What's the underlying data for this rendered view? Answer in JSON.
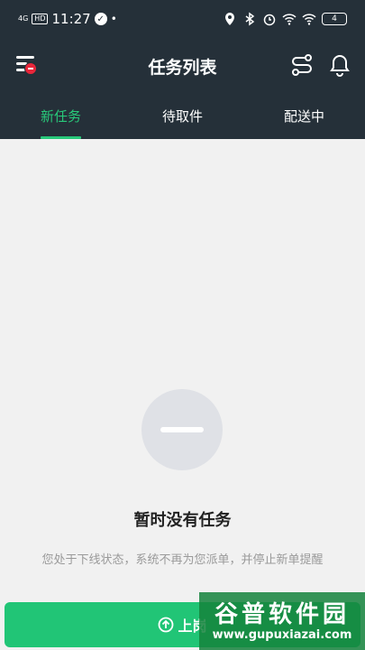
{
  "status_bar": {
    "signal": "4G",
    "hd": "HD",
    "time": "11:27",
    "battery": "4"
  },
  "header": {
    "title": "任务列表",
    "icons": {
      "menu": "menu-icon",
      "route": "route-icon",
      "bell": "bell-icon"
    }
  },
  "tabs": [
    {
      "label": "新任务",
      "active": true
    },
    {
      "label": "待取件",
      "active": false
    },
    {
      "label": "配送中",
      "active": false
    }
  ],
  "empty_state": {
    "title": "暂时没有任务",
    "description": "您处于下线状态，系统不再为您派单，并停止新单提醒"
  },
  "bottom_button": {
    "label": "上岗"
  },
  "watermark": {
    "main": "谷普软件园",
    "sub": "www.gupuxiazai.com"
  },
  "colors": {
    "header_bg": "#253039",
    "accent_green": "#21c576",
    "page_bg": "#f1f1f1"
  }
}
